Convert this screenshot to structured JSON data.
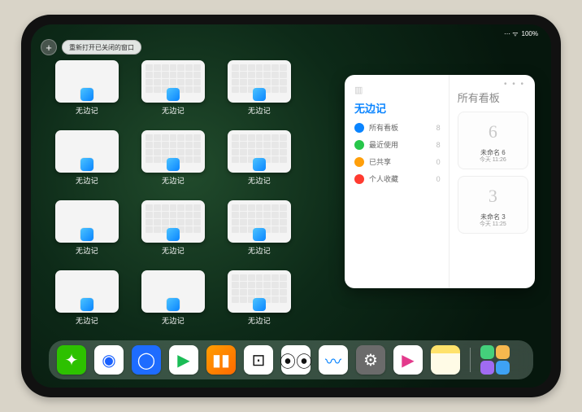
{
  "status": {
    "wifi": "⋯ ᯤ",
    "battery": "100%"
  },
  "top": {
    "plus": "+",
    "pill": "重新打开已关闭的窗口"
  },
  "app_name": "无边记",
  "grid": {
    "rows": [
      [
        "blank",
        "calendar",
        "calendar"
      ],
      [
        "blank",
        "calendar",
        "calendar"
      ],
      [
        "blank",
        "calendar",
        "calendar"
      ],
      [
        "blank",
        "blank",
        "calendar"
      ]
    ]
  },
  "panel": {
    "title_left": "无边记",
    "title_right": "所有看板",
    "menu": [
      {
        "label": "所有看板",
        "count": "8",
        "color": "#0a84ff"
      },
      {
        "label": "最近使用",
        "count": "8",
        "color": "#27c64a"
      },
      {
        "label": "已共享",
        "count": "0",
        "color": "#ff9f0a"
      },
      {
        "label": "个人收藏",
        "count": "0",
        "color": "#ff3b30"
      }
    ],
    "boards": [
      {
        "sketch": "6",
        "name": "未命名 6",
        "time": "今天 11:26"
      },
      {
        "sketch": "3",
        "name": "未命名 3",
        "time": "今天 11:25"
      }
    ]
  },
  "dock": {
    "apps": [
      {
        "name": "wechat",
        "bg": "#2dc100",
        "glyph": "✦"
      },
      {
        "name": "quark-hd",
        "bg": "#ffffff",
        "glyph": "◉",
        "fg": "#1860ff"
      },
      {
        "name": "qqbrowser",
        "bg": "#1e6cff",
        "glyph": "◯"
      },
      {
        "name": "video-1",
        "bg": "#ffffff",
        "glyph": "▶",
        "fg": "#1abc56"
      },
      {
        "name": "books",
        "bg": "linear-gradient(135deg,#ff9d00,#ff6a00)",
        "glyph": "▮▮"
      },
      {
        "name": "game",
        "bg": "#ffffff",
        "glyph": "⊡",
        "fg": "#111"
      },
      {
        "name": "barbell",
        "bg": "#ffffff",
        "glyph": "⦿⦿",
        "fg": "#111"
      },
      {
        "name": "freeform",
        "bg": "#ffffff",
        "glyph": "〰",
        "fg": "#0a84ff"
      },
      {
        "name": "settings",
        "bg": "#6b6b6b",
        "glyph": "⚙"
      },
      {
        "name": "video-2",
        "bg": "#ffffff",
        "glyph": "▶",
        "fg": "#e33a8c"
      },
      {
        "name": "notes",
        "bg": "linear-gradient(#ffe26b 28%,#fffbe6 28%)",
        "glyph": ""
      }
    ]
  }
}
